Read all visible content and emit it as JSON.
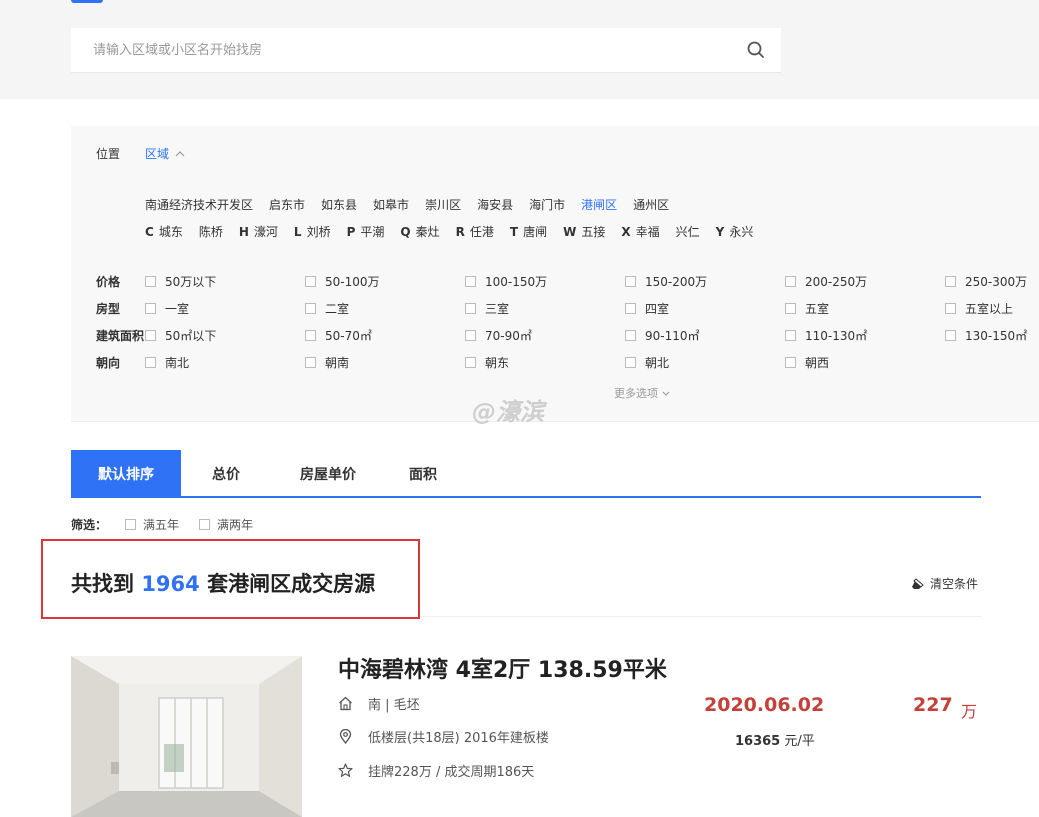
{
  "search": {
    "placeholder": "请输入区域或小区名开始找房"
  },
  "filter": {
    "location_label": "位置",
    "region_tab": "区域",
    "districts": [
      "南通经济技术开发区",
      "启东市",
      "如东县",
      "如皋市",
      "崇川区",
      "海安县",
      "海门市",
      "港闸区",
      "通州区"
    ],
    "active_district": "港闸区",
    "towns": [
      {
        "letter": "C",
        "name": "城东"
      },
      {
        "letter": "",
        "name": "陈桥"
      },
      {
        "letter": "H",
        "name": "濠河"
      },
      {
        "letter": "L",
        "name": "刘桥"
      },
      {
        "letter": "P",
        "name": "平潮"
      },
      {
        "letter": "Q",
        "name": "秦灶"
      },
      {
        "letter": "R",
        "name": "任港"
      },
      {
        "letter": "T",
        "name": "唐闸"
      },
      {
        "letter": "W",
        "name": "五接"
      },
      {
        "letter": "X",
        "name": "幸福"
      },
      {
        "letter": "",
        "name": "兴仁"
      },
      {
        "letter": "Y",
        "name": "永兴"
      }
    ],
    "rows": [
      {
        "label": "价格",
        "options": [
          "50万以下",
          "50-100万",
          "100-150万",
          "150-200万",
          "200-250万",
          "250-300万"
        ]
      },
      {
        "label": "房型",
        "options": [
          "一室",
          "二室",
          "三室",
          "四室",
          "五室",
          "五室以上"
        ]
      },
      {
        "label": "建筑面积",
        "options": [
          "50㎡以下",
          "50-70㎡",
          "70-90㎡",
          "90-110㎡",
          "110-130㎡",
          "130-150㎡"
        ]
      },
      {
        "label": "朝向",
        "options": [
          "南北",
          "朝南",
          "朝东",
          "朝北",
          "朝西"
        ]
      }
    ],
    "more": "更多选项"
  },
  "watermark": "@濠滨",
  "sort": {
    "tabs": [
      "默认排序",
      "总价",
      "房屋单价",
      "面积"
    ],
    "active": "默认排序"
  },
  "screen": {
    "label": "筛选：",
    "options": [
      "满五年",
      "满两年"
    ]
  },
  "result": {
    "prefix": "共找到",
    "count": "1964",
    "suffix": "套港闸区成交房源"
  },
  "clear_label": "清空条件",
  "listing": {
    "title": "中海碧林湾 4室2厅 138.59平米",
    "orientation": "南 | 毛坯",
    "floor": "低楼层(共18层) 2016年建板楼",
    "listing_info": "挂牌228万 / 成交周期186天",
    "deal_date": "2020.06.02",
    "total_price": "227",
    "price_unit": "万",
    "unit_price": "16365",
    "unit_price_suffix": "元/平"
  },
  "colors": {
    "accent": "#3072f6",
    "price": "#c4403a",
    "highlight_box": "#d9363e"
  }
}
